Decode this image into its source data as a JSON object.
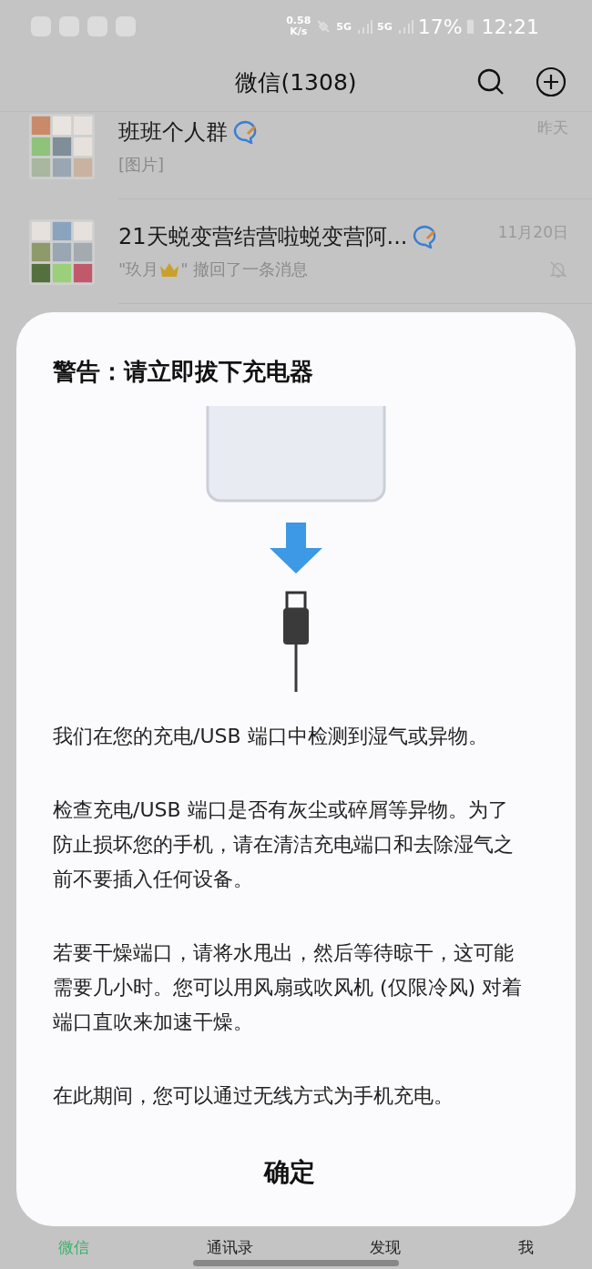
{
  "status_bar": {
    "speed": "0.58",
    "speed_unit": "K/s",
    "network_1": "5G",
    "network_2": "5G",
    "battery": "17%",
    "time": "12:21"
  },
  "header": {
    "title": "微信(1308)"
  },
  "chats": [
    {
      "name": "班班个人群",
      "preview": [
        {
          "kind": "text",
          "text": "[图片]"
        }
      ],
      "time": "昨天",
      "muted": false
    },
    {
      "name": "21天蜕变营结营啦蜕变营阿...",
      "preview": [
        {
          "kind": "text",
          "text": "\"玖月"
        },
        {
          "kind": "crown"
        },
        {
          "kind": "text",
          "text": "\" 撤回了一条消息"
        }
      ],
      "time": "11月20日",
      "muted": true
    }
  ],
  "dialog": {
    "title": "警告：请立即拔下充电器",
    "paragraphs": [
      "我们在您的充电/USB 端口中检测到湿气或异物。",
      "检查充电/USB 端口是否有灰尘或碎屑等异物。为了防止损坏您的手机，请在清洁充电端口和去除湿气之前不要插入任何设备。",
      "若要干燥端口，请将水甩出，然后等待晾干，这可能需要几小时。您可以用风扇或吹风机 (仅限冷风) 对着端口直吹来加速干燥。",
      "在此期间，您可以通过无线方式为手机充电。"
    ],
    "button": "确定"
  },
  "tabs": [
    {
      "label": "微信",
      "selected": true
    },
    {
      "label": "通讯录",
      "selected": false
    },
    {
      "label": "发现",
      "selected": false
    },
    {
      "label": "我",
      "selected": false
    }
  ]
}
